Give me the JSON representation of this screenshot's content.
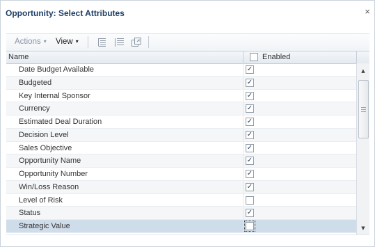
{
  "dialog": {
    "title": "Opportunity: Select Attributes",
    "close_glyph": "×"
  },
  "toolbar": {
    "actions_label": "Actions",
    "view_label": "View",
    "caret_glyph": "▾",
    "icons": [
      "expand-all-icon",
      "collapse-all-icon",
      "detach-icon"
    ]
  },
  "table": {
    "columns": {
      "name": "Name",
      "enabled": "Enabled"
    },
    "rows": [
      {
        "name": "Date Budget Available",
        "enabled": true
      },
      {
        "name": "Budgeted",
        "enabled": true
      },
      {
        "name": "Key Internal Sponsor",
        "enabled": true
      },
      {
        "name": "Currency",
        "enabled": true
      },
      {
        "name": "Estimated Deal Duration",
        "enabled": true
      },
      {
        "name": "Decision Level",
        "enabled": true
      },
      {
        "name": "Sales Objective",
        "enabled": true
      },
      {
        "name": "Opportunity Name",
        "enabled": true
      },
      {
        "name": "Opportunity Number",
        "enabled": true
      },
      {
        "name": "Win/Loss Reason",
        "enabled": true
      },
      {
        "name": "Level of Risk",
        "enabled": false
      },
      {
        "name": "Status",
        "enabled": true
      },
      {
        "name": "Strategic Value",
        "enabled": false
      }
    ],
    "selected_row": "Strategic Value",
    "check_glyph": "✓"
  },
  "scrollbar": {
    "up_glyph": "▲",
    "down_glyph": "▼"
  },
  "colors": {
    "title": "#1f3f66",
    "selected_row": "#cfdcea",
    "header_bg": "#e4eaf0"
  }
}
